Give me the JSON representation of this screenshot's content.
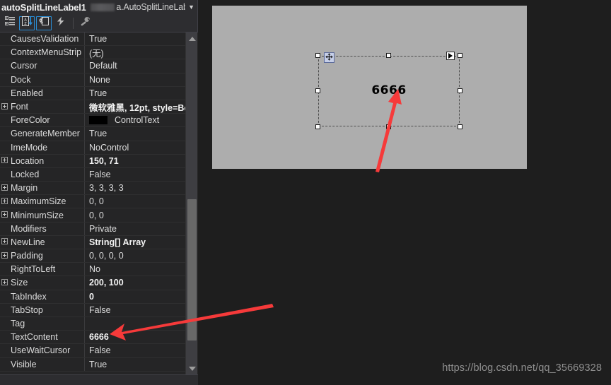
{
  "window": {
    "background_color": "#1e1e1e"
  },
  "properties_panel": {
    "header": {
      "object_name": "autoSplitLineLabel1",
      "object_type": "a.AutoSplitLineLab",
      "dropdown_icon": "chevron-down-icon"
    },
    "toolbar": {
      "buttons": [
        {
          "name": "categorized-button",
          "icon": "categorized-icon",
          "active": false
        },
        {
          "name": "alphabetical-button",
          "icon": "sort-az-icon",
          "active": true
        },
        {
          "name": "properties-button",
          "icon": "properties-page-icon",
          "active": true
        },
        {
          "name": "events-button",
          "icon": "lightning-bolt-icon",
          "active": false
        },
        {
          "name": "property-pages-button",
          "icon": "wrench-icon",
          "active": false
        }
      ]
    },
    "rows": [
      {
        "expandable": false,
        "name": "CausesValidation",
        "value": "True",
        "bold": false,
        "swatch": null
      },
      {
        "expandable": false,
        "name": "ContextMenuStrip",
        "value": "(无)",
        "bold": false,
        "swatch": null
      },
      {
        "expandable": false,
        "name": "Cursor",
        "value": "Default",
        "bold": false,
        "swatch": null
      },
      {
        "expandable": false,
        "name": "Dock",
        "value": "None",
        "bold": false,
        "swatch": null
      },
      {
        "expandable": false,
        "name": "Enabled",
        "value": "True",
        "bold": false,
        "swatch": null
      },
      {
        "expandable": true,
        "name": "Font",
        "value": "微软雅黑, 12pt, style=Bo",
        "bold": true,
        "swatch": null
      },
      {
        "expandable": false,
        "name": "ForeColor",
        "value": "ControlText",
        "bold": false,
        "swatch": "#000000"
      },
      {
        "expandable": false,
        "name": "GenerateMember",
        "value": "True",
        "bold": false,
        "swatch": null
      },
      {
        "expandable": false,
        "name": "ImeMode",
        "value": "NoControl",
        "bold": false,
        "swatch": null
      },
      {
        "expandable": true,
        "name": "Location",
        "value": "150, 71",
        "bold": true,
        "swatch": null
      },
      {
        "expandable": false,
        "name": "Locked",
        "value": "False",
        "bold": false,
        "swatch": null
      },
      {
        "expandable": true,
        "name": "Margin",
        "value": "3, 3, 3, 3",
        "bold": false,
        "swatch": null
      },
      {
        "expandable": true,
        "name": "MaximumSize",
        "value": "0, 0",
        "bold": false,
        "swatch": null
      },
      {
        "expandable": true,
        "name": "MinimumSize",
        "value": "0, 0",
        "bold": false,
        "swatch": null
      },
      {
        "expandable": false,
        "name": "Modifiers",
        "value": "Private",
        "bold": false,
        "swatch": null
      },
      {
        "expandable": true,
        "name": "NewLine",
        "value": "String[] Array",
        "bold": true,
        "swatch": null
      },
      {
        "expandable": true,
        "name": "Padding",
        "value": "0, 0, 0, 0",
        "bold": false,
        "swatch": null
      },
      {
        "expandable": false,
        "name": "RightToLeft",
        "value": "No",
        "bold": false,
        "swatch": null
      },
      {
        "expandable": true,
        "name": "Size",
        "value": "200, 100",
        "bold": true,
        "swatch": null
      },
      {
        "expandable": false,
        "name": "TabIndex",
        "value": "0",
        "bold": true,
        "swatch": null
      },
      {
        "expandable": false,
        "name": "TabStop",
        "value": "False",
        "bold": false,
        "swatch": null
      },
      {
        "expandable": false,
        "name": "Tag",
        "value": "",
        "bold": false,
        "swatch": null
      },
      {
        "expandable": false,
        "name": "TextContent",
        "value": "6666",
        "bold": true,
        "swatch": null
      },
      {
        "expandable": false,
        "name": "UseWaitCursor",
        "value": "False",
        "bold": false,
        "swatch": null
      },
      {
        "expandable": false,
        "name": "Visible",
        "value": "True",
        "bold": false,
        "swatch": null
      }
    ],
    "scrollbar": {
      "up_icon": "scroll-up-arrow-icon",
      "down_icon": "scroll-down-arrow-icon"
    }
  },
  "designer": {
    "surface_color": "#adadad",
    "selected_control": {
      "label_text": "6666",
      "location": "150, 71",
      "size": "200, 100",
      "move_handle_icon": "move-four-arrows-icon",
      "smart_tag_icon": "smart-tag-triangle-icon"
    }
  },
  "annotations": {
    "arrow_color": "#f63a3a",
    "arrow_to_label": "arrow-pointing-to-designer-label",
    "arrow_to_textcontent": "arrow-pointing-to-textcontent-value"
  },
  "watermark": {
    "text": "https://blog.csdn.net/qq_35669328"
  }
}
